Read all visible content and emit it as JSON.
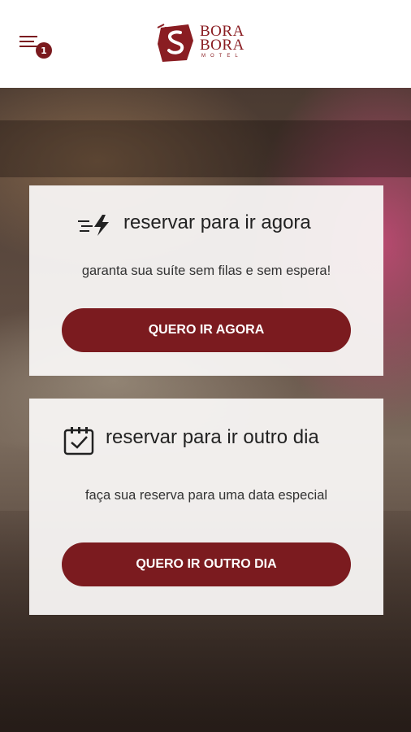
{
  "header": {
    "cart_count": "1",
    "logo": {
      "line1": "BORA",
      "line2": "BORA",
      "sub": "MOTEL"
    }
  },
  "colors": {
    "brand": "#7b1b1f",
    "header_bg": "#ffffff",
    "card_bg": "#f8f6f4"
  },
  "cards": [
    {
      "icon": "fast-lightning-icon",
      "title": "reservar para ir agora",
      "subtitle": "garanta sua suíte sem filas e sem espera!",
      "button": "QUERO IR AGORA"
    },
    {
      "icon": "calendar-check-icon",
      "title": "reservar para ir outro dia",
      "subtitle": "faça sua reserva para uma data especial",
      "button": "QUERO IR OUTRO DIA"
    }
  ]
}
